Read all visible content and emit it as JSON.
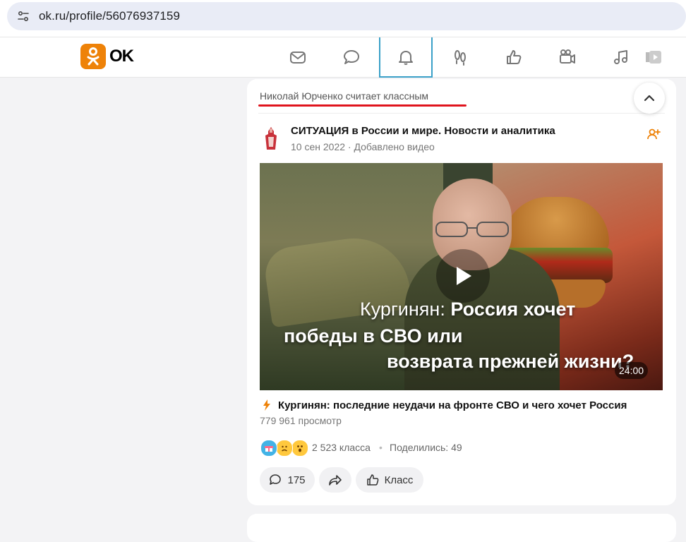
{
  "browser": {
    "url": "ok.ru/profile/56076937159",
    "settings_icon": "site-settings-icon"
  },
  "header": {
    "logo_text": "OK",
    "brand_color": "#ee8208",
    "nav_icons": [
      "messages-icon",
      "discussions-icon",
      "notifications-icon",
      "guests-icon",
      "marks-icon",
      "video-icon",
      "music-icon",
      "play-icon"
    ],
    "active_icon": "notifications-icon"
  },
  "post": {
    "liked_by": "Николай Юрченко считает классным",
    "group_name": "СИТУАЦИЯ в России и мире. Новости и аналитика",
    "meta": "10 сен 2022 · Добавлено видео",
    "video": {
      "overlay_line1_normal": "Кургинян: ",
      "overlay_line1_bold": "Россия хочет",
      "overlay_line2": "победы в СВО или",
      "overlay_line3": "возврата прежней жизни?",
      "duration": "24:00"
    },
    "title": "Кургинян: последние неудачи на фронте СВО и чего хочет Россия",
    "views": "779 961 просмотр",
    "likes": "2 523 класса",
    "separator": "•",
    "shared": "Поделились: 49",
    "actions": {
      "comments_count": "175",
      "like_label": "Класс"
    }
  }
}
